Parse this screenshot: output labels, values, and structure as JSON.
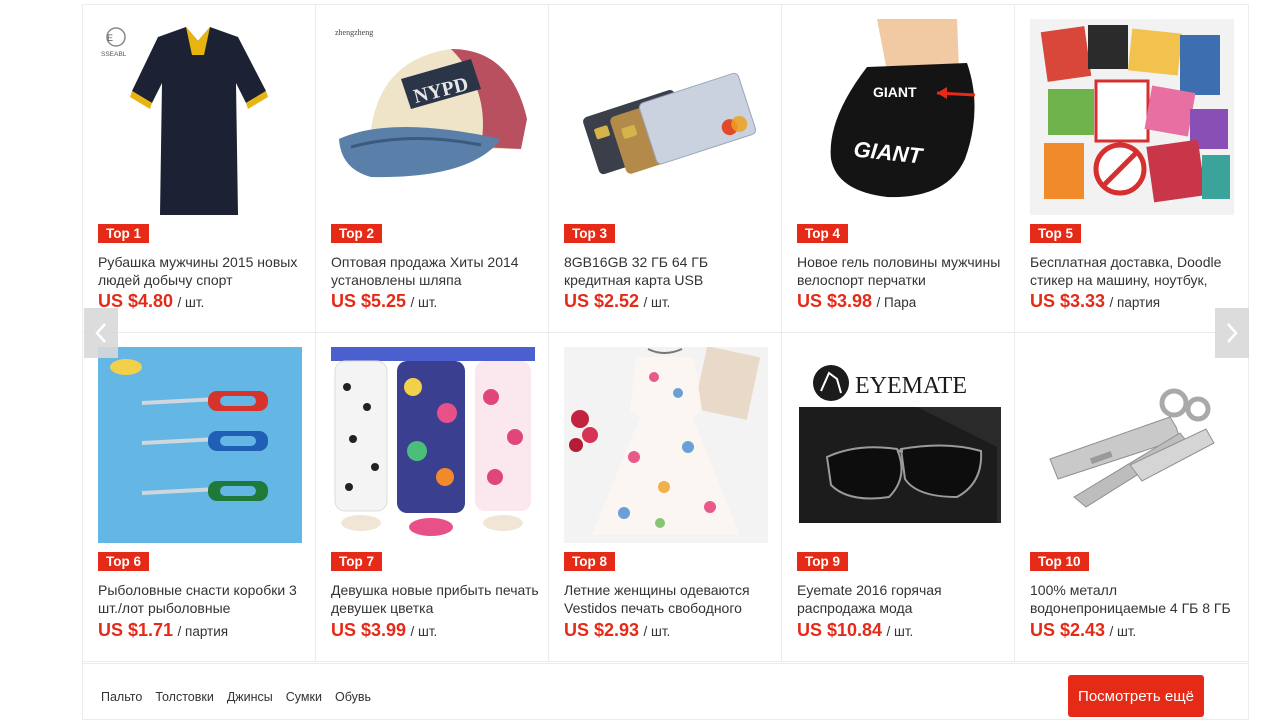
{
  "products": [
    {
      "rank": "Top 1",
      "title": "Рубашка мужчины 2015 новых людей добычу спорт",
      "price": "US $4.80",
      "unit": "/ шт.",
      "image": "navy-polo-shirt",
      "brand_mark": "SSEABL"
    },
    {
      "rank": "Top 2",
      "title": "Оптовая продажа Хиты 2014 установлены шляпа",
      "price": "US $5.25",
      "unit": "/ шт.",
      "image": "nypd-baseball-cap",
      "brand_mark": "zhengzheng"
    },
    {
      "rank": "Top 3",
      "title": "8GB16GB 32 ГБ 64 ГБ кредитная карта USB",
      "price": "US $2.52",
      "unit": "/ шт.",
      "image": "credit-card-usb-drives"
    },
    {
      "rank": "Top 4",
      "title": "Новое гель половины мужчины велоспорт перчатки",
      "price": "US $3.98",
      "unit": "/ Пара",
      "image": "giant-cycling-glove",
      "brand_mark": "GIANT"
    },
    {
      "rank": "Top 5",
      "title": "Бесплатная доставка, Doodle стикер на машину, ноутбук,",
      "price": "US $3.33",
      "unit": "/ партия",
      "image": "doodle-sticker-pack"
    },
    {
      "rank": "Top 6",
      "title": "Рыболовные снасти коробки 3 шт./лот рыболовные",
      "price": "US $1.71",
      "unit": "/ партия",
      "image": "fishing-line-scissors"
    },
    {
      "rank": "Top 7",
      "title": "Девушка новые прибыть печать девушек цветка",
      "price": "US $3.99",
      "unit": "/ шт.",
      "image": "girls-printed-leggings"
    },
    {
      "rank": "Top 8",
      "title": "Летние женщины одеваются Vestidos печать свободного",
      "price": "US $2.93",
      "unit": "/ шт.",
      "image": "summer-print-dress"
    },
    {
      "rank": "Top 9",
      "title": "Eyemate 2016 горячая распродажа мода",
      "price": "US $10.84",
      "unit": "/ шт.",
      "image": "eyemate-sunglasses",
      "brand_mark": "EYEMATE"
    },
    {
      "rank": "Top 10",
      "title": "100% металл водонепроницаемые 4 ГБ 8 ГБ",
      "price": "US $2.43",
      "unit": "/ шт.",
      "image": "metal-key-usb-drive"
    }
  ],
  "footer": {
    "categories": [
      "Пальто",
      "Толстовки",
      "Джинсы",
      "Сумки",
      "Обувь"
    ],
    "more_button": "Посмотреть ещё"
  },
  "colors": {
    "accent": "#e52b17",
    "text": "#333333",
    "border": "#ececec",
    "arrow_bg": "#d9d9d9"
  }
}
